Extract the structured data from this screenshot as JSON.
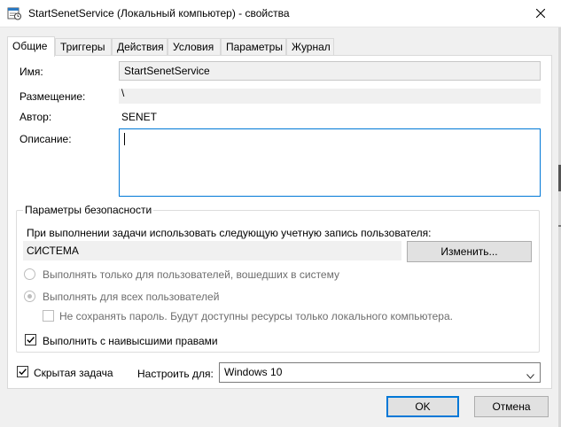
{
  "window": {
    "title": "StartSenetService (Локальный компьютер) - свойства",
    "app_icon": "task-scheduler-icon",
    "close_icon": "close-icon"
  },
  "tabs": [
    {
      "label": "Общие",
      "active": true
    },
    {
      "label": "Триггеры",
      "active": false
    },
    {
      "label": "Действия",
      "active": false
    },
    {
      "label": "Условия",
      "active": false
    },
    {
      "label": "Параметры",
      "active": false
    },
    {
      "label": "Журнал",
      "active": false
    }
  ],
  "general": {
    "name_label": "Имя:",
    "name_value": "StartSenetService",
    "location_label": "Размещение:",
    "location_value": "\\",
    "author_label": "Автор:",
    "author_value": "SENET",
    "description_label": "Описание:",
    "description_value": ""
  },
  "security": {
    "group_title": "Параметры безопасности",
    "account_prompt": "При выполнении задачи использовать следующую учетную запись пользователя:",
    "account_value": "СИСТЕМА",
    "change_button": "Изменить...",
    "radio_logged_on": "Выполнять только для пользователей, вошедших в систему",
    "radio_all_users": "Выполнять для всех пользователей",
    "radio_selected": "all_users",
    "no_store_password": "Не сохранять пароль. Будут доступны ресурсы только локального компьютера.",
    "no_store_password_checked": false,
    "highest_privileges": "Выполнить с наивысшими правами",
    "highest_privileges_checked": true
  },
  "footer": {
    "hidden_task": "Скрытая задача",
    "hidden_task_checked": true,
    "configure_for_label": "Настроить для:",
    "configure_for_value": "Windows 10",
    "ok_button": "OK",
    "cancel_button": "Отмена"
  },
  "colors": {
    "accent": "#0078d7",
    "window_bg": "#f0f0f0",
    "panel_bg": "#ffffff",
    "disabled_text": "#6d6d6d"
  }
}
